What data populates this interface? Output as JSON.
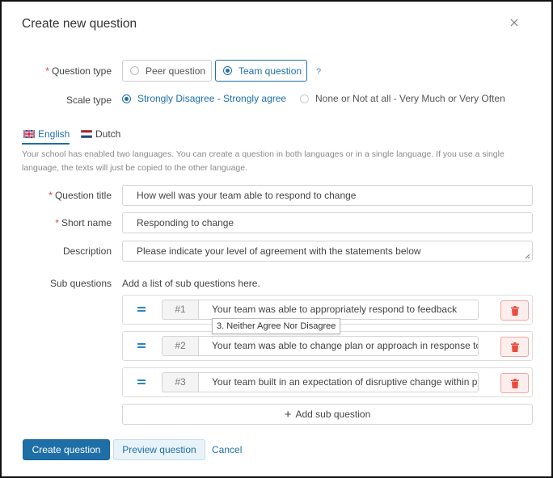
{
  "dialog": {
    "title": "Create new question"
  },
  "question_type": {
    "label": "Question type",
    "options": [
      "Peer question",
      "Team question"
    ],
    "selected": "Team question",
    "help": "?"
  },
  "scale_type": {
    "label": "Scale type",
    "options": [
      "Strongly Disagree - Strongly agree",
      "None or Not at all - Very Much or Very Often"
    ],
    "selected": "Strongly Disagree - Strongly agree"
  },
  "languages": {
    "tabs": [
      "English",
      "Dutch"
    ],
    "active": "English",
    "note": "Your school has enabled two languages. You can create a question in both languages or in a single language. If you use a single language, the texts will just be copied to the other language."
  },
  "form": {
    "title_label": "Question title",
    "title_value": "How well was your team able to respond to change",
    "short_label": "Short name",
    "short_value": "Responding to change",
    "description_label": "Description",
    "description_value": "Please indicate your level of agreement with the statements below"
  },
  "sub_questions": {
    "label": "Sub questions",
    "hint": "Add a list of sub questions here.",
    "items": [
      {
        "number": "#1",
        "text": "Your team was able to appropriately respond to feedback"
      },
      {
        "number": "#2",
        "text": "Your team was able to change plan or approach in response to"
      },
      {
        "number": "#3",
        "text": "Your team built in an expectation of disruptive change within p"
      }
    ],
    "tooltip": "3. Neither Agree Nor Disagree",
    "add_label": "Add sub question"
  },
  "footer": {
    "create": "Create question",
    "preview": "Preview question",
    "cancel": "Cancel"
  },
  "colors": {
    "accent": "#1e6fa8",
    "required": "#e0453e",
    "danger": "#e74c3c"
  }
}
